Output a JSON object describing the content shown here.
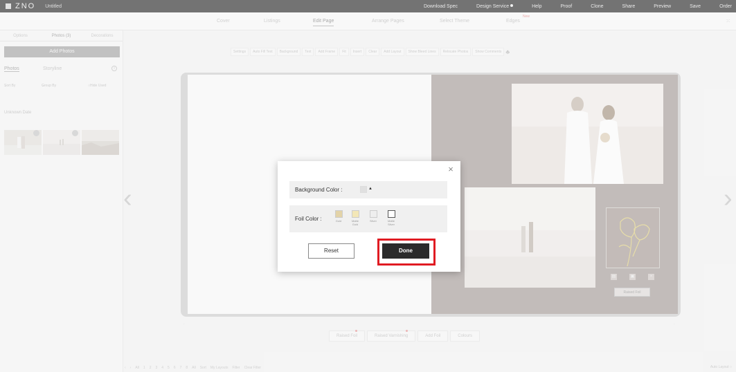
{
  "app": {
    "logo": "ZNO",
    "doc_title": "Untitled"
  },
  "topnav": {
    "items": [
      "Download Spec",
      "Design Service",
      "Help",
      "Proof",
      "Clone",
      "Share",
      "Preview",
      "Save",
      "Order"
    ]
  },
  "tabs": {
    "items": [
      "Cover",
      "Listings",
      "Edit Page",
      "Arrange Pages",
      "Select Theme",
      "Edges"
    ],
    "new_badge": "New"
  },
  "left_panel": {
    "tabs": [
      "Options",
      "Photos (3)",
      "Decorations"
    ],
    "add_photos": "Add Photos",
    "sub_photos": "Photos",
    "sub_storyline": "Storyline",
    "sort_by": "Sort By",
    "group_by": "Group By",
    "hide_used": "Hide Used",
    "unknown_date": "Unknown Date"
  },
  "toolbar": {
    "items": [
      "Settings",
      "Auto Fill Text",
      "Background",
      "Text",
      "Add Frame",
      "Fit",
      "Insert",
      "Clear",
      "Add Layout",
      "Show Bleed Lines",
      "Relocate Photos",
      "Show Comments"
    ]
  },
  "spread": {
    "raised_foil_tag": "Raised Foil"
  },
  "bottom_buttons": [
    "Raised Foil",
    "Raised Varnishing",
    "Add Foil",
    "Colours"
  ],
  "bottom_nav": [
    "All",
    "1",
    "2",
    "3",
    "4",
    "5",
    "6",
    "7",
    "8",
    "All",
    "Sort",
    "My Layouts",
    "Filter",
    "Clear Filter"
  ],
  "auto_layout": "Auto Layout",
  "modal": {
    "background_label": "Background Color :",
    "foil_label": "Foil Color :",
    "foil_options": [
      {
        "name": "Gold",
        "color": "#e3d3a8"
      },
      {
        "name": "Matte Gold",
        "color": "#f3e7b7"
      },
      {
        "name": "Silver",
        "color": "#eeeeee"
      },
      {
        "name": "Matte Silver",
        "color": "#ffffff"
      }
    ],
    "reset": "Reset",
    "done": "Done"
  },
  "colors": {
    "highlight": "#e01b22",
    "done_bg": "#2b2b2b"
  }
}
